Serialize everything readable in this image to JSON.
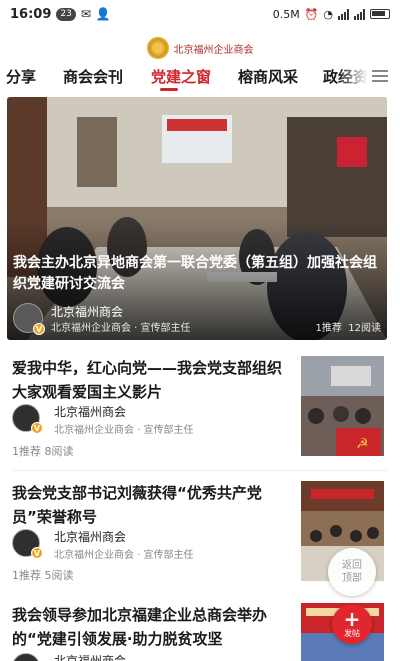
{
  "status_bar": {
    "time": "16:09",
    "notif_count": "23",
    "net_speed": "0.5M",
    "battery_icon": "battery-icon",
    "wifi_icon": "wifi-icon"
  },
  "header": {
    "logo_text": "北京福州企业商会"
  },
  "tabs": [
    {
      "label": "分享",
      "active": false
    },
    {
      "label": "商会会刊",
      "active": false
    },
    {
      "label": "党建之窗",
      "active": true
    },
    {
      "label": "榕商风采",
      "active": false
    },
    {
      "label": "政经资",
      "active": false
    }
  ],
  "colors": {
    "accent": "#d4232d",
    "badge": "#f0a321"
  },
  "hero": {
    "title": "我会主办北京异地商会第一联合党委（第五组）加强社会组织党建研讨交流会",
    "author": "北京福州商会",
    "subtitle": "北京福州企业商会 · 宣传部主任",
    "recommend": "1推荐",
    "reads": "12阅读"
  },
  "articles": [
    {
      "title": "爱我中华，红心向党——我会党支部组织大家观看爱国主义影片",
      "author": "北京福州商会",
      "subtitle": "北京福州企业商会 · 宣传部主任",
      "stats": "1推荐  8阅读"
    },
    {
      "title": "我会党支部书记刘薇获得“优秀共产党员”荣誉称号",
      "author": "北京福州商会",
      "subtitle": "北京福州企业商会 · 宣传部主任",
      "stats": "1推荐  5阅读"
    },
    {
      "title": "我会领导参加北京福建企业总商会举办的“党建引领发展·助力脱贫攻坚",
      "author": "北京福州商会",
      "subtitle": "",
      "stats": ""
    }
  ],
  "floating": {
    "back_top": "返回顶部",
    "publish": "发帖"
  }
}
